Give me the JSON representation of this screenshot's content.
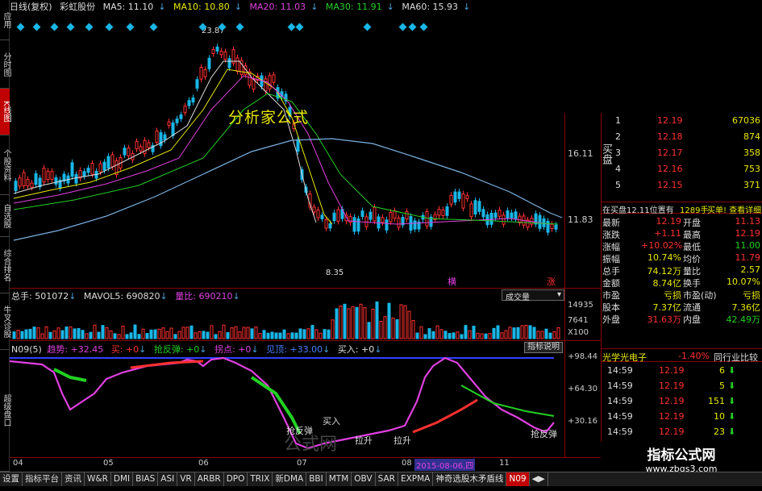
{
  "header": {
    "period": "日线(复权)",
    "stock": "彩虹股份",
    "ma5": "MA5: 11.10",
    "ma10": "MA10: 10.80",
    "ma20": "MA20: 11.03",
    "ma30": "MA30: 11.91",
    "ma60": "MA60: 15.93"
  },
  "left_tabs": [
    "应用",
    "分时图",
    "K线图",
    "个股资料",
    "自选股",
    "综合排名",
    "牛叉诊股",
    "超级盘口"
  ],
  "main_chart": {
    "overlay_text": "分析家公式",
    "high_label": "23.87",
    "low_label": "8.35",
    "yaxis": [
      "16.11",
      "11.83"
    ],
    "markers": [
      "横",
      "涨"
    ]
  },
  "volume_panel": {
    "label_total": "总手: 501072",
    "label_mavol": "MAVOL5: 690820",
    "label_ratio": "量比: 690210",
    "dropdown": "成交量",
    "yaxis": [
      "14935",
      "7641",
      "X100"
    ]
  },
  "indicator_panel": {
    "name": "N09(5)",
    "trend": "趋势: +32.45",
    "buy": "买: +0",
    "rebound": "抢反弹: +0",
    "rise": "拐点: +0",
    "top": "见顶: +33.00",
    "buy_in": "买入: +0",
    "help_button": "指标说明",
    "yaxis": [
      "+98.44",
      "+64.30",
      "+30.16"
    ],
    "annotations": [
      "抢反弹",
      "买入",
      "拉升",
      "拉升",
      "抢反弹"
    ],
    "watermark": "公式网"
  },
  "date_axis": {
    "labels": [
      "04",
      "05",
      "06",
      "07",
      "08",
      "11"
    ],
    "highlight": "2015-08-06,四"
  },
  "order_book": {
    "side_label": "买盘",
    "rows": [
      {
        "level": "1",
        "price": "12.19",
        "vol": "67036"
      },
      {
        "level": "2",
        "price": "12.18",
        "vol": "874"
      },
      {
        "level": "3",
        "price": "12.17",
        "vol": "358"
      },
      {
        "level": "4",
        "price": "12.16",
        "vol": "753"
      },
      {
        "level": "5",
        "price": "12.15",
        "vol": "371"
      }
    ],
    "note": "在买盘12.11位置有",
    "note_vol": "1289手",
    "note_action": "买单! 查看详细"
  },
  "stats": [
    [
      "最新",
      "12.19",
      "开盘",
      "11.13"
    ],
    [
      "涨跌",
      "+1.11",
      "最高",
      "12.19"
    ],
    [
      "涨幅",
      "+10.02%",
      "最低",
      "11.00"
    ],
    [
      "振幅",
      "10.74%",
      "均价",
      "11.79"
    ],
    [
      "总手",
      "74.12万",
      "量比",
      "2.57"
    ],
    [
      "金额",
      "8.74亿",
      "换手",
      "10.07%"
    ],
    [
      "市盈",
      "亏损",
      "市盈(动)",
      "亏损"
    ],
    [
      "股本",
      "7.37亿",
      "流通",
      "7.36亿"
    ],
    [
      "外盘",
      "31.63万",
      "内盘",
      "42.49万"
    ]
  ],
  "sector": {
    "name": "光学光电子",
    "change": "-1.40%",
    "compare": "同行业比较"
  },
  "ticks": [
    {
      "time": "14:59",
      "price": "12.19",
      "vol": "6"
    },
    {
      "time": "14:59",
      "price": "12.19",
      "vol": "5"
    },
    {
      "time": "14:59",
      "price": "12.19",
      "vol": "151"
    },
    {
      "time": "14:59",
      "price": "12.19",
      "vol": "10"
    },
    {
      "time": "14:59",
      "price": "12.19",
      "vol": "23"
    }
  ],
  "bottom_tabs": [
    "设置",
    "指标平台",
    "资讯",
    "W&R",
    "DMI",
    "BIAS",
    "ASI",
    "VR",
    "ARBR",
    "DPO",
    "TRIX",
    "新DMA",
    "BBI",
    "MTM",
    "OBV",
    "SAR",
    "EXPMA",
    "神奇选股木矛盾线",
    "N09",
    "◀▶"
  ],
  "logo": {
    "title": "指标公式网",
    "url": "www.zbgs3.com"
  },
  "colors": {
    "red": "#ff3030",
    "green": "#22d022",
    "cyan": "#19b6e6",
    "magenta": "#e040e0",
    "yellow": "#e8e800"
  }
}
